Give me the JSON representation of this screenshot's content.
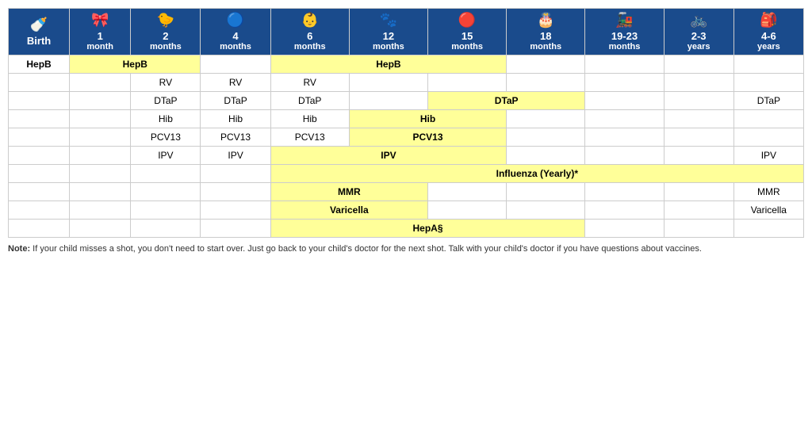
{
  "table": {
    "headers": [
      {
        "id": "birth",
        "icon": "🍼",
        "age": "Birth",
        "unit": ""
      },
      {
        "id": "1m",
        "icon": "🎀",
        "age": "1",
        "unit": "month"
      },
      {
        "id": "2m",
        "icon": "🐤",
        "age": "2",
        "unit": "months"
      },
      {
        "id": "4m",
        "icon": "🔵",
        "age": "4",
        "unit": "months"
      },
      {
        "id": "6m",
        "icon": "👶",
        "age": "6",
        "unit": "months"
      },
      {
        "id": "12m",
        "icon": "🐾",
        "age": "12",
        "unit": "months"
      },
      {
        "id": "15m",
        "icon": "🔴",
        "age": "15",
        "unit": "months"
      },
      {
        "id": "18m",
        "icon": "🎂",
        "age": "18",
        "unit": "months"
      },
      {
        "id": "1923m",
        "icon": "🚂",
        "age": "19-23",
        "unit": "months"
      },
      {
        "id": "23y",
        "icon": "🚲",
        "age": "2-3",
        "unit": "years"
      },
      {
        "id": "46y",
        "icon": "🎒",
        "age": "4-6",
        "unit": "years"
      }
    ],
    "rows": [
      {
        "vaccine": "HepB",
        "cells": [
          {
            "col": "birth",
            "type": "yellow",
            "text": "",
            "colspan": 1
          },
          {
            "col": "1m",
            "type": "yellow",
            "text": "HepB",
            "colspan": 2
          },
          {
            "col": "4m",
            "type": "empty",
            "text": "",
            "colspan": 1
          },
          {
            "col": "6m",
            "type": "yellow",
            "text": "HepB",
            "colspan": 3
          },
          {
            "col": "18m",
            "type": "empty",
            "text": "",
            "colspan": 1
          },
          {
            "col": "1923m",
            "type": "empty",
            "text": "",
            "colspan": 1
          },
          {
            "col": "23y",
            "type": "empty",
            "text": "",
            "colspan": 1
          },
          {
            "col": "46y",
            "type": "empty",
            "text": "",
            "colspan": 1
          }
        ]
      }
    ],
    "note": {
      "bold": "Note:",
      "text": " If your child misses a shot, you don't need to start over. Just go back to your child's doctor for the next shot. Talk with your child's doctor if you have questions about vaccines."
    }
  }
}
